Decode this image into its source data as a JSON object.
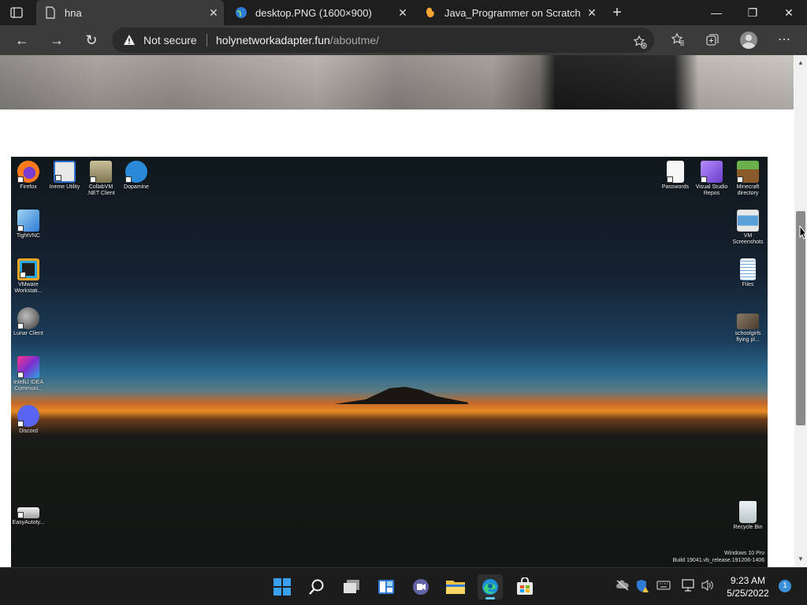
{
  "browser": {
    "tabs": [
      {
        "title": "hna",
        "close": "✕"
      },
      {
        "title": "desktop.PNG (1600×900)",
        "close": "✕"
      },
      {
        "title": "Java_Programmer on Scratch",
        "close": "✕"
      }
    ],
    "new_tab": "+",
    "window_controls": {
      "minimize": "—",
      "restore": "❐",
      "close": "✕"
    },
    "nav": {
      "back": "←",
      "forward": "→",
      "refresh": "↻"
    },
    "security_label": "Not secure",
    "url_host": "holynetworkadapter.fun",
    "url_path": "/aboutme/",
    "toolbar_icons": [
      "add-favorite-icon",
      "favorites-icon",
      "collections-icon",
      "profile-icon",
      "more-icon"
    ],
    "more": "⋯"
  },
  "desktop": {
    "left_icons": [
      {
        "label": "Firefox",
        "color": "#ff7a1a"
      },
      {
        "label": "Ineme Utility",
        "color": "#d9d9d9"
      },
      {
        "label": "CollabVM\n.NET Client",
        "color": "#8a7a4a"
      },
      {
        "label": "Dopamine",
        "color": "#2b8ad8"
      },
      {
        "label": "TightVNC",
        "color": "#4aa3d8"
      },
      {
        "label": "VMware\nWorkstati...",
        "color": "#f5a623"
      },
      {
        "label": "Lunar Client",
        "color": "#3a3a3a"
      },
      {
        "label": "IntelliJ IDEA\nCommuni...",
        "color": "#7b2fd0"
      },
      {
        "label": "Discord",
        "color": "#5865f2"
      },
      {
        "label": "EasyAutoty...",
        "color": "#d0d0d0"
      }
    ],
    "right_icons": [
      {
        "label": "Passwords",
        "color": "#f0f0f0"
      },
      {
        "label": "Visual Studio\nRepos",
        "color": "#8a5cd8"
      },
      {
        "label": "Minecraft\ndirectory",
        "color": "#5a8a3a"
      },
      {
        "label": "VM\nScreenshots",
        "color": "#e8e8e8"
      },
      {
        "label": "Files",
        "color": "#ffffff"
      },
      {
        "label": "schoolgirls\nflying pl...",
        "color": "#6a5a4a"
      },
      {
        "label": "Recycle Bin",
        "color": "#cfd8dc"
      }
    ],
    "watermark_line1": "Windows 10 Pro",
    "watermark_line2": "Build 19041.vb_release.191206-1406"
  },
  "taskbar": {
    "apps": [
      "start-icon",
      "search-icon",
      "task-view-icon",
      "widgets-icon",
      "teams-chat-icon",
      "file-explorer-icon",
      "edge-icon",
      "store-icon"
    ],
    "time": "9:23 AM",
    "date": "5/25/2022",
    "notification_count": "1"
  },
  "colors": {
    "accent": "#60cdff",
    "warning": "#f0f0f0"
  }
}
